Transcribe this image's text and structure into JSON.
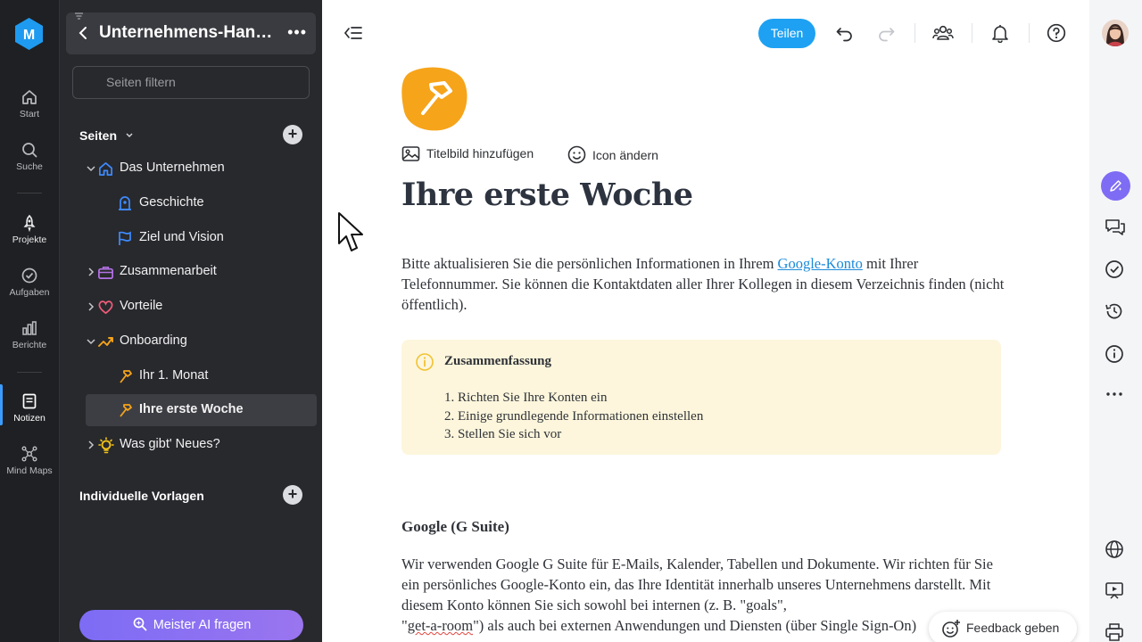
{
  "rail": {
    "items": [
      {
        "label": "Start",
        "icon": "home-icon"
      },
      {
        "label": "Suche",
        "icon": "search-icon"
      },
      {
        "label": "Projekte",
        "icon": "rocket-icon"
      },
      {
        "label": "Aufgaben",
        "icon": "check-circle-icon"
      },
      {
        "label": "Berichte",
        "icon": "bar-chart-icon"
      },
      {
        "label": "Notizen",
        "icon": "notes-icon",
        "active": true
      },
      {
        "label": "Mind Maps",
        "icon": "mindmap-icon"
      }
    ]
  },
  "sidebar": {
    "title": "Unternehmens-Handbuch",
    "filter_placeholder": "Seiten filtern",
    "pages_heading": "Seiten",
    "tree": [
      {
        "label": "Das Unternehmen",
        "icon": "home-outline-icon"
      },
      {
        "label": "Geschichte",
        "icon": "bell-badge-icon"
      },
      {
        "label": "Ziel und Vision",
        "icon": "flag-icon"
      },
      {
        "label": "Zusammenarbeit",
        "icon": "briefcase-icon"
      },
      {
        "label": "Vorteile",
        "icon": "heart-icon"
      },
      {
        "label": "Onboarding",
        "icon": "path-icon"
      },
      {
        "label": "Ihr 1. Monat",
        "icon": "hammer-icon"
      },
      {
        "label": "Ihre erste Woche",
        "icon": "hammer-icon",
        "selected": true
      },
      {
        "label": "Was gibt' Neues?",
        "icon": "lightbulb-icon"
      }
    ],
    "templates_heading": "Individuelle Vorlagen",
    "ai_button": "Meister AI fragen"
  },
  "toolbar": {
    "share_label": "Teilen"
  },
  "page": {
    "add_cover": "Titelbild hinzufügen",
    "change_icon": "Icon ändern",
    "title": "Ihre erste Woche",
    "intro_before": "Bitte aktualisieren Sie die persönlichen Informationen in Ihrem ",
    "intro_link": "Google-Konto",
    "intro_after": " mit Ihrer Telefonnummer. Sie können die Kontaktdaten aller Ihrer Kollegen in diesem Verzeichnis finden (nicht öffentlich).",
    "callout": {
      "title": "Zusammenfassung",
      "items": [
        "1. Richten Sie Ihre Konten ein",
        "2. Einige grundlegende Informationen einstellen",
        "3. Stellen Sie sich vor"
      ]
    },
    "section_heading": "Google (G Suite)",
    "section_text_1": "Wir verwenden Google G Suite für E-Mails, Kalender, Tabellen und Dokumente. Wir richten für Sie ein persönliches Google-Konto ein, das Ihre Identität innerhalb unseres Unternehmens darstellt. Mit diesem Konto können Sie sich sowohl bei internen (z. B. \"goals\",",
    "section_text_quote_open": "\"",
    "section_text_spell": "get-a-room",
    "section_text_2": "\") als auch bei externen Anwendungen und Diensten (über Single Sign-On)"
  },
  "feedback_label": "Feedback geben",
  "colors": {
    "accent": "#1ea1f2",
    "ai_purple": "#7e6cf4",
    "callout_bg": "#fdf6dc",
    "sidebar_bg": "#28292d",
    "rail_bg": "#1f2023",
    "page_icon": "#f6a41a"
  }
}
